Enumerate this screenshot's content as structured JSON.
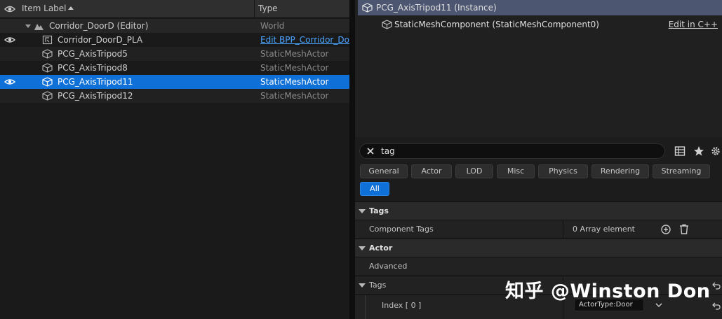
{
  "outliner": {
    "header": {
      "label_col": "Item Label",
      "type_col": "Type"
    },
    "rows": [
      {
        "name": "Corridor_DoorD (Editor)",
        "type": "World"
      },
      {
        "name": "Corridor_DoorD_PLA",
        "type": "Edit BPP_Corridor_Door"
      },
      {
        "name": "PCG_AxisTripod5",
        "type": "StaticMeshActor"
      },
      {
        "name": "PCG_AxisTripod8",
        "type": "StaticMeshActor"
      },
      {
        "name": "PCG_AxisTripod11",
        "type": "StaticMeshActor"
      },
      {
        "name": "PCG_AxisTripod12",
        "type": "StaticMeshActor"
      }
    ]
  },
  "details": {
    "components": {
      "instance": "PCG_AxisTripod11 (Instance)",
      "component": "StaticMeshComponent (StaticMeshComponent0)",
      "edit_link": "Edit in C++"
    },
    "search": {
      "value": "tag"
    },
    "filters": [
      "General",
      "Actor",
      "LOD",
      "Misc",
      "Physics",
      "Rendering",
      "Streaming",
      "All"
    ],
    "sections": {
      "tags": {
        "title": "Tags",
        "component_tags_label": "Component Tags",
        "component_tags_value": "0 Array element"
      },
      "actor": {
        "title": "Actor",
        "advanced_label": "Advanced",
        "tags_label": "Tags",
        "index_label": "Index [ 0 ]",
        "index_value": "ActorType:Door"
      }
    }
  },
  "watermark": "知乎 @Winston Don",
  "colors": {
    "selection": "#0f70d7",
    "component_selection": "#4c5670",
    "link": "#4aa3ff"
  }
}
